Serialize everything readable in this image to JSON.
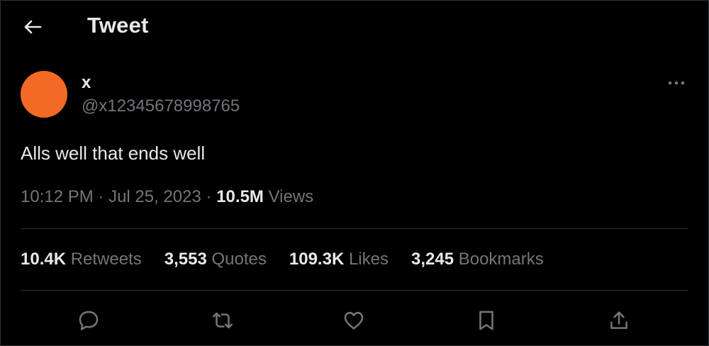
{
  "header": {
    "title": "Tweet",
    "back_icon": "arrow-left-icon"
  },
  "author": {
    "display_name": "x",
    "handle": "@x12345678998765",
    "avatar_color": "#f26a23",
    "more_icon": "more-horizontal-icon"
  },
  "tweet": {
    "text": "Alls well that ends well",
    "time": "10:12 PM",
    "separator": "·",
    "date": "Jul 25, 2023",
    "views_count": "10.5M",
    "views_label": "Views"
  },
  "stats": [
    {
      "count": "10.4K",
      "label": "Retweets"
    },
    {
      "count": "3,553",
      "label": "Quotes"
    },
    {
      "count": "109.3K",
      "label": "Likes"
    },
    {
      "count": "3,245",
      "label": "Bookmarks"
    }
  ],
  "actions": [
    {
      "name": "reply",
      "icon": "reply-icon"
    },
    {
      "name": "retweet",
      "icon": "retweet-icon"
    },
    {
      "name": "like",
      "icon": "heart-icon"
    },
    {
      "name": "bookmark",
      "icon": "bookmark-icon"
    },
    {
      "name": "share",
      "icon": "share-icon"
    }
  ],
  "colors": {
    "background": "#000000",
    "primary_text": "#e7e9ea",
    "secondary_text": "#71767b",
    "divider": "#2f3336"
  }
}
